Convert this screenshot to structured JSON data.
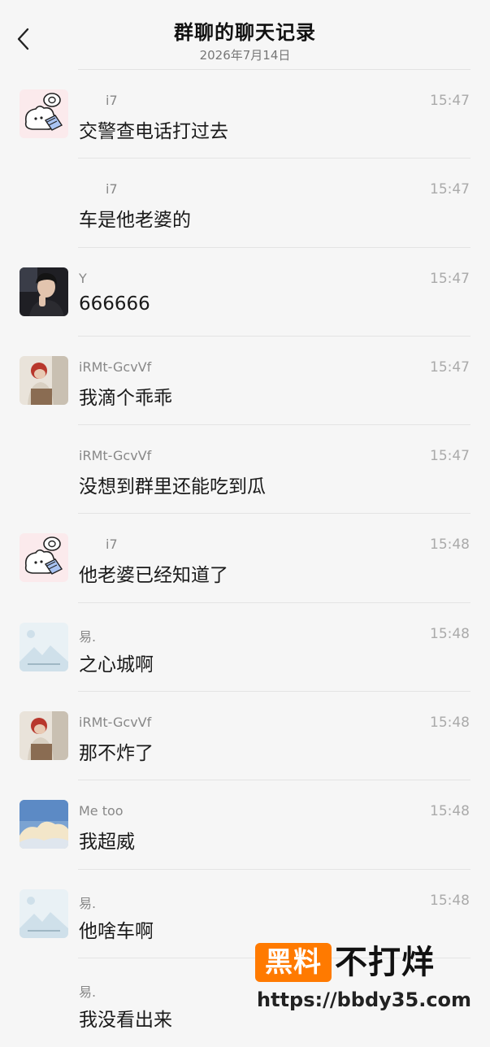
{
  "header": {
    "title": "群聊的聊天记录",
    "date": "2026年7月14日"
  },
  "messages": [
    {
      "name": "i7",
      "time": "15:47",
      "text": "交警查电话打过去",
      "avatar": "cartoon-cat",
      "name_indent": true
    },
    {
      "name": "i7",
      "time": "15:47",
      "text": "车是他老婆的",
      "avatar": "none",
      "name_indent": true
    },
    {
      "name": "Y",
      "time": "15:47",
      "text": "666666",
      "avatar": "photo-man"
    },
    {
      "name": "iRMt-GcvVf",
      "time": "15:47",
      "text": "我滴个乖乖",
      "avatar": "photo-red-hair"
    },
    {
      "name": "iRMt-GcvVf",
      "time": "15:47",
      "text": "没想到群里还能吃到瓜",
      "avatar": "none"
    },
    {
      "name": "i7",
      "time": "15:48",
      "text": "他老婆已经知道了",
      "avatar": "cartoon-cat",
      "name_indent": true
    },
    {
      "name": "易.",
      "time": "15:48",
      "text": "之心城啊",
      "avatar": "mountain-sky"
    },
    {
      "name": "iRMt-GcvVf",
      "time": "15:48",
      "text": "那不炸了",
      "avatar": "photo-red-hair"
    },
    {
      "name": "Me too",
      "time": "15:48",
      "text": "我超威",
      "avatar": "sky-clouds"
    },
    {
      "name": "易.",
      "time": "15:48",
      "text": "他啥车啊",
      "avatar": "mountain-sky"
    },
    {
      "name": "易.",
      "time": "",
      "text": "我没看出来",
      "avatar": "none"
    }
  ],
  "watermark": {
    "badge": "黑料",
    "brand": "不打烊",
    "url": "https://bbdy35.com"
  },
  "colors": {
    "accent": "#ff7a00",
    "background": "#f6f6f6"
  }
}
